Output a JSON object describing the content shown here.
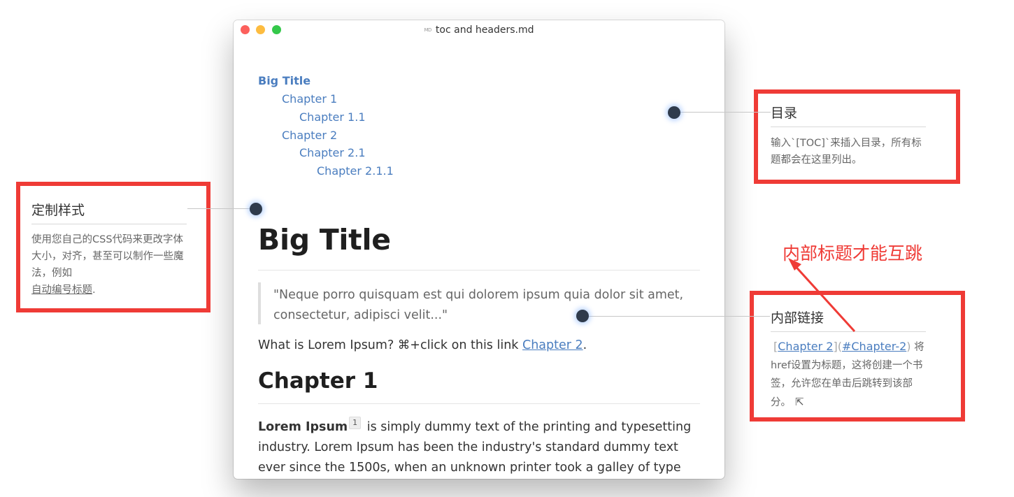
{
  "window": {
    "title": "toc and headers.md",
    "file_icon": "MD",
    "toc": [
      {
        "label": "Big Title",
        "level": 0
      },
      {
        "label": "Chapter 1",
        "level": 1
      },
      {
        "label": "Chapter 1.1",
        "level": 2
      },
      {
        "label": "Chapter 2",
        "level": 1
      },
      {
        "label": "Chapter 2.1",
        "level": 2
      },
      {
        "label": "Chapter 2.1.1",
        "level": 3
      }
    ],
    "heading1": "Big Title",
    "blockquote": "\"Neque porro quisquam est qui dolorem ipsum quia dolor sit amet, consectetur, adipisci velit...\"",
    "para1": {
      "prefix": "What is Lorem Ipsum? ⌘+click on this link ",
      "link": "Chapter 2",
      "suffix": "."
    },
    "heading2": "Chapter 1",
    "para2": {
      "bold": "Lorem Ipsum",
      "footnote": "1",
      "text": " is simply dummy text of the printing and typesetting industry. Lorem Ipsum has been the industry's standard dummy text ever since the 1500s, when an unknown printer took a galley of type and scrambled it to make a type specimen book. It has survived not only five"
    }
  },
  "callouts": {
    "toc": {
      "title": "目录",
      "description": "输入`[TOC]`来插入目录，所有标题都会在这里列出。"
    },
    "custom_style": {
      "title": "定制样式",
      "description": "使用您自己的CSS代码来更改字体大小，对齐，甚至可以制作一些魔法，例如",
      "link": "自动编号标题",
      "suffix": "."
    },
    "internal_link": {
      "title": "内部链接",
      "open_bracket": "[",
      "link_text": "Chapter 2",
      "middle": "](",
      "anchor": "#Chapter-2",
      "close_paren": ")",
      "description": " 将href设置为标题，这将创建一个书签，允许您在单击后跳转到该部分。",
      "icon": "external-link-icon"
    },
    "annotation": "内部标题才能互跳"
  },
  "colors": {
    "frame": "#ef3b36",
    "link": "#4a7dbf",
    "dot": "#2f3b4c"
  }
}
